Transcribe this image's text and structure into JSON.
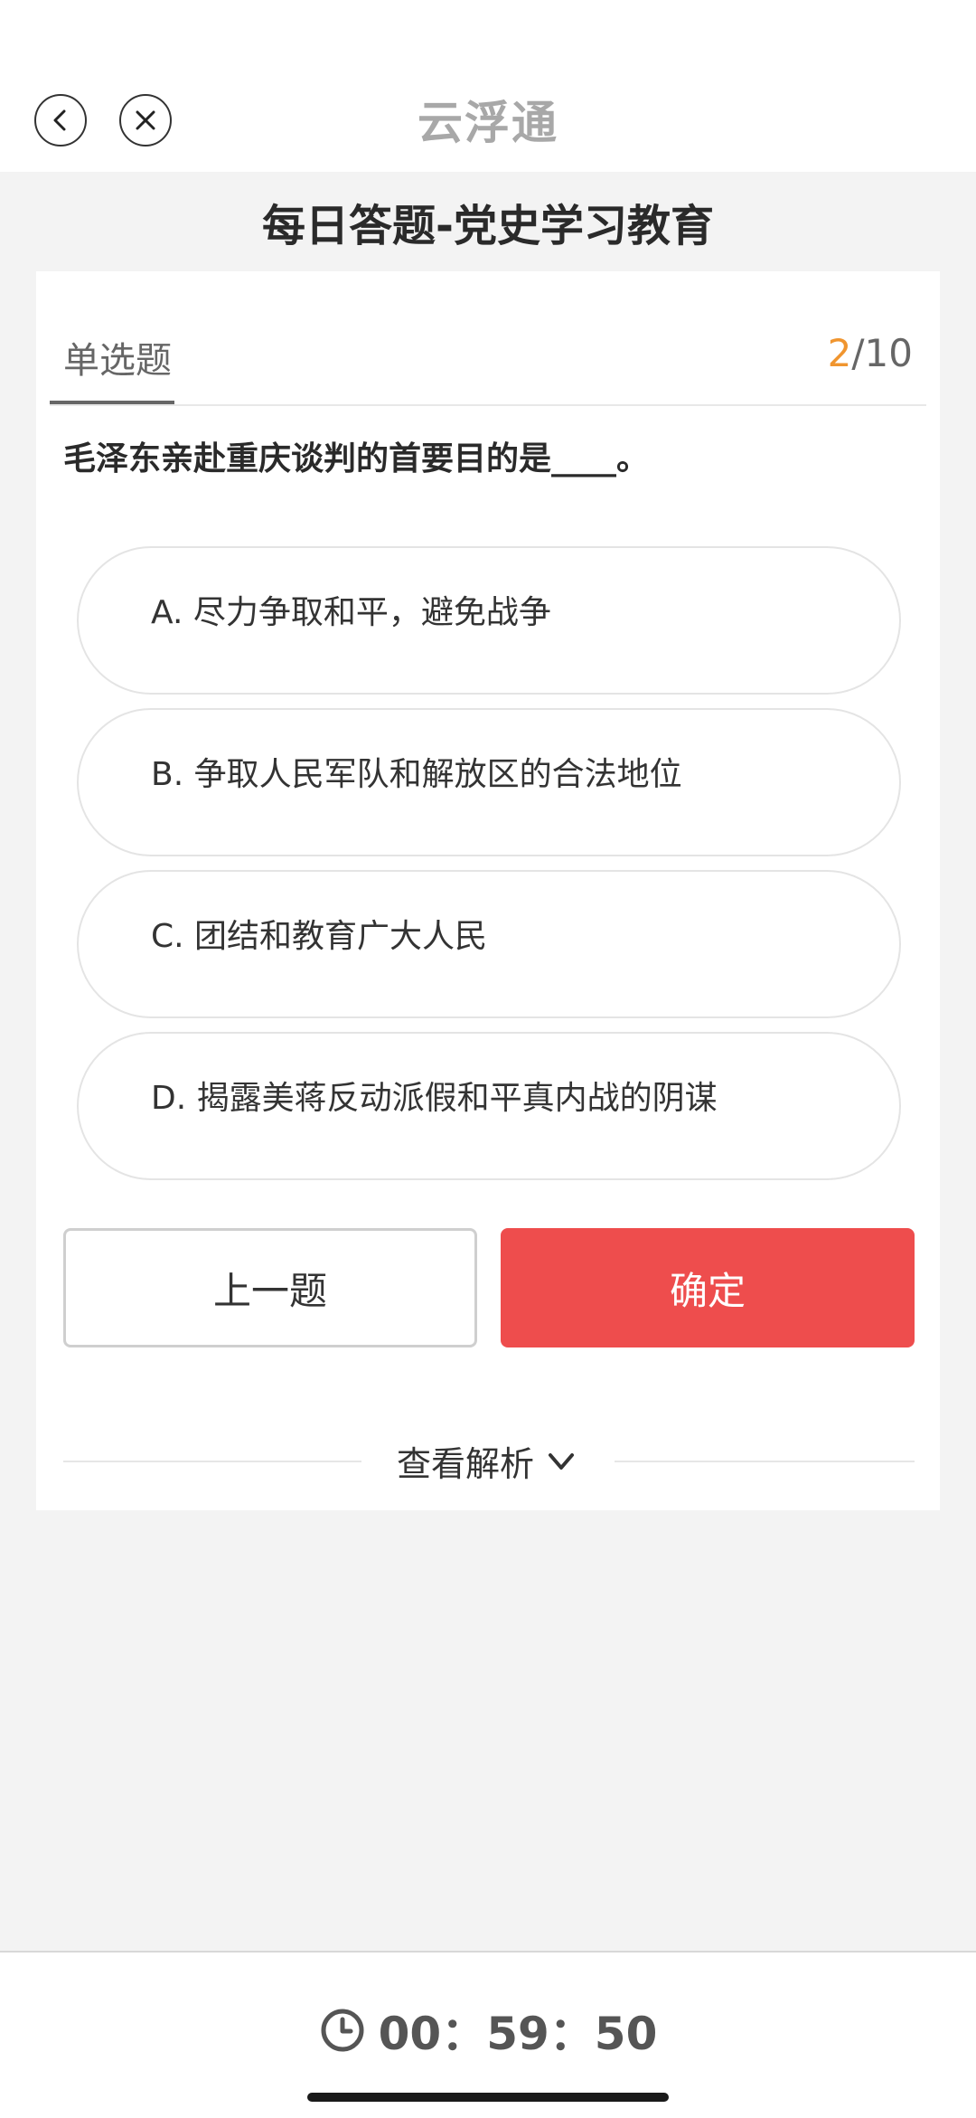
{
  "header": {
    "brand": "云浮通",
    "back_icon": "chevron-left-icon",
    "close_icon": "close-icon"
  },
  "page_title": "每日答题-党史学习教育",
  "quiz": {
    "question_type": "单选题",
    "current": "2",
    "total": "/10",
    "question": "毛泽东亲赴重庆谈判的首要目的是____。",
    "options": [
      "A. 尽力争取和平，避免战争",
      "B. 争取人民军队和解放区的合法地位",
      "C. 团结和教育广大人民",
      "D. 揭露美蒋反动派假和平真内战的阴谋"
    ],
    "prev_label": "上一题",
    "confirm_label": "确定",
    "analysis_label": "查看解析"
  },
  "timer": {
    "value": "00：59：50"
  },
  "colors": {
    "accent_orange": "#f0952f",
    "confirm_red": "#ee4d4d",
    "background": "#f3f3f3"
  }
}
